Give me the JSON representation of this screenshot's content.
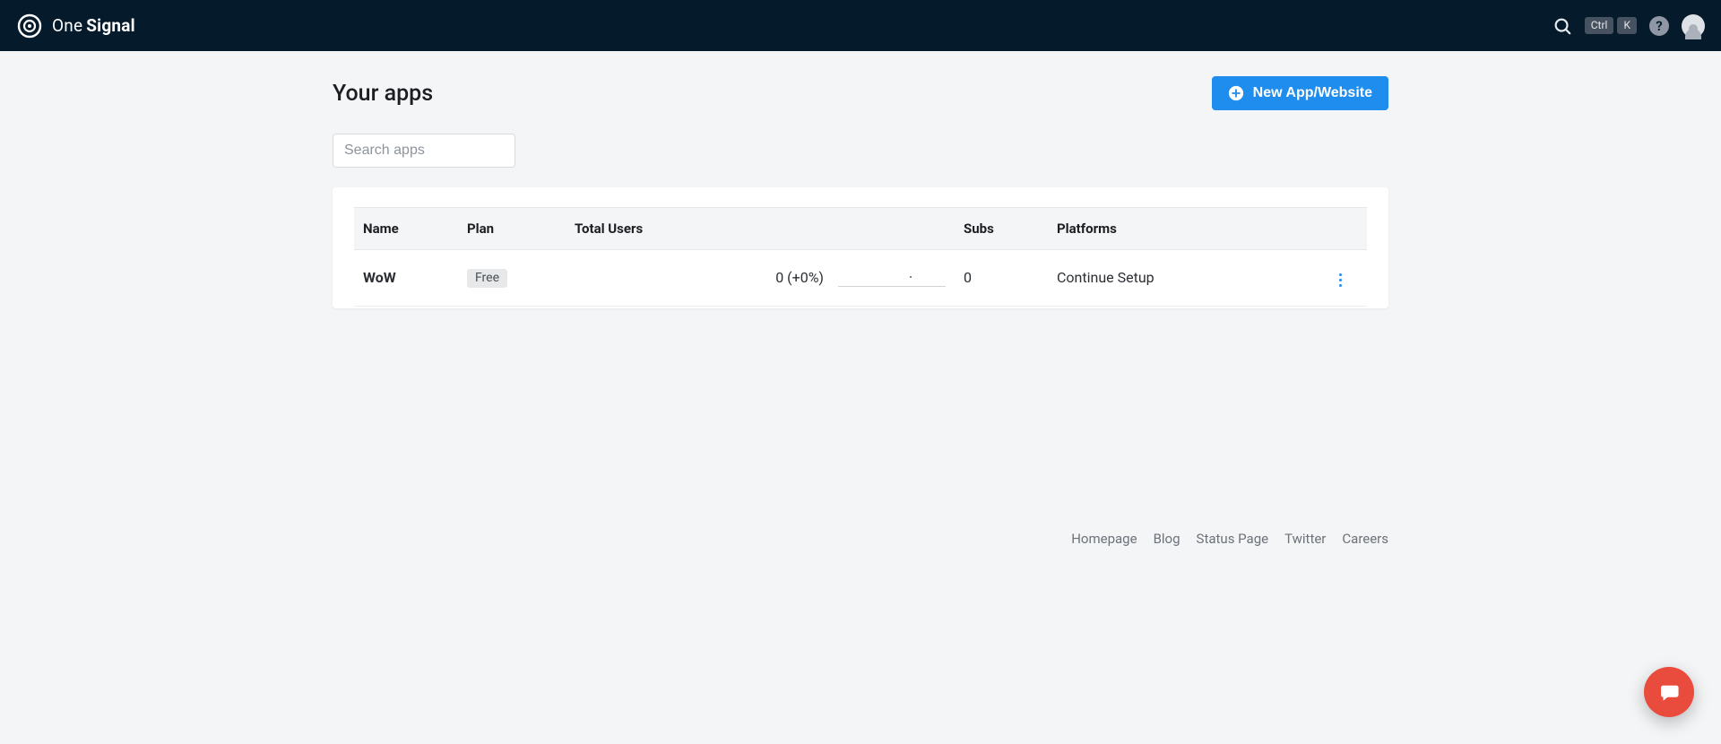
{
  "brand": {
    "one": "One",
    "signal": "Signal"
  },
  "nav": {
    "kbd1": "Ctrl",
    "kbd2": "K"
  },
  "page": {
    "title": "Your apps",
    "new_app_label": "New App/Website",
    "search_placeholder": "Search apps"
  },
  "table": {
    "headers": {
      "name": "Name",
      "plan": "Plan",
      "total_users": "Total Users",
      "subs": "Subs",
      "platforms": "Platforms"
    },
    "rows": [
      {
        "name": "WoW",
        "plan": "Free",
        "total_users": "0 (+0%)",
        "subs": "0",
        "platforms": "Continue Setup"
      }
    ]
  },
  "footer": {
    "links": [
      "Homepage",
      "Blog",
      "Status Page",
      "Twitter",
      "Careers"
    ]
  }
}
